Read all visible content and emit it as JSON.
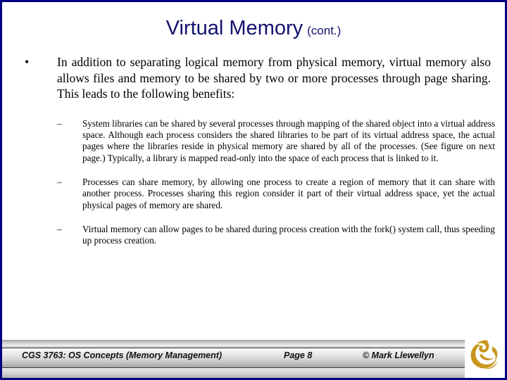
{
  "slide": {
    "border_color": "#000080",
    "background": "#ffffff"
  },
  "title": {
    "main": "Virtual Memory",
    "suffix": "(cont.)",
    "color": "#121270"
  },
  "content": {
    "bullet_marker": "•",
    "sub_marker": "–",
    "main_bullet": "In addition to separating logical memory from physical memory, virtual memory also allows files and memory to be shared by two or more processes through page sharing.  This leads to the following benefits:",
    "sub_bullets": [
      "System libraries can be shared by several processes through mapping of the shared object into a virtual address space.  Although each process considers the shared libraries to be part of its virtual address space, the actual pages where the libraries reside in physical memory are shared by all of the processes.  (See figure on next page.)  Typically, a library is mapped read-only into the space of each process that is linked to it.",
      "Processes can share memory, by allowing one process to create a region of memory that it can share with another process.  Processes sharing this region consider it part of their virtual address space, yet the actual physical pages of memory are shared.",
      "Virtual memory can allow pages to be shared during process creation with the fork() system call, thus speeding up process creation."
    ]
  },
  "footer": {
    "course": "CGS 3763: OS Concepts  (Memory Management)",
    "page": "Page 8",
    "copyright": "© Mark Llewellyn",
    "logo_name": "ucf-pegasus-logo",
    "logo_color": "#c8961e"
  }
}
